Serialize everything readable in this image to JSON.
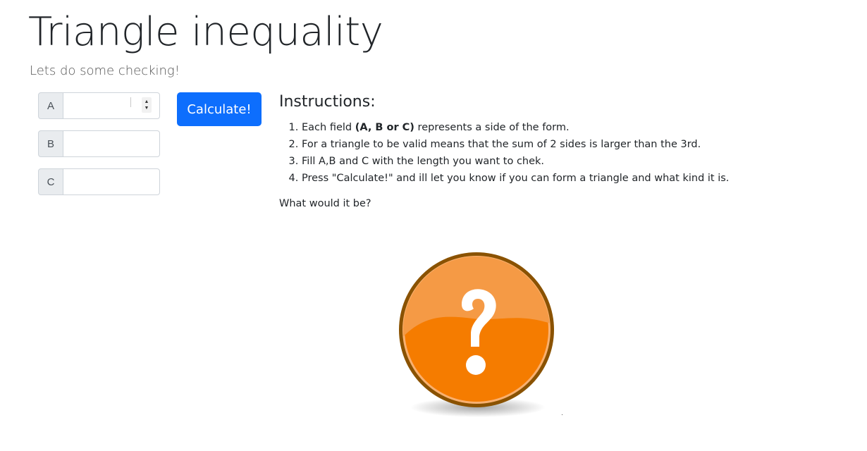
{
  "header": {
    "title": "Triangle inequality",
    "subtitle": "Lets do some checking!"
  },
  "form": {
    "fields": [
      {
        "label": "A",
        "value": ""
      },
      {
        "label": "B",
        "value": ""
      },
      {
        "label": "C",
        "value": ""
      }
    ],
    "calculate_label": "Calculate!"
  },
  "instructions": {
    "heading": "Instructions:",
    "items": [
      {
        "prefix": "Each field ",
        "bold": "(A, B or C)",
        "suffix": " represents a side of the form."
      },
      {
        "text": "For a triangle to be valid means that the sum of 2 sides is larger than the 3rd."
      },
      {
        "text": "Fill A,B and C with the length you want to chek."
      },
      {
        "text": "Press \"Calculate!\" and ill let you know if you can form a triangle and what kind it is."
      }
    ]
  },
  "result": {
    "question": "What would it be?",
    "icon": "question-mark-icon",
    "icon_colors": {
      "fill": "#f57c00",
      "highlight": "#f7a04a",
      "rim": "#8a5200",
      "glyph": "#ffffff"
    }
  }
}
